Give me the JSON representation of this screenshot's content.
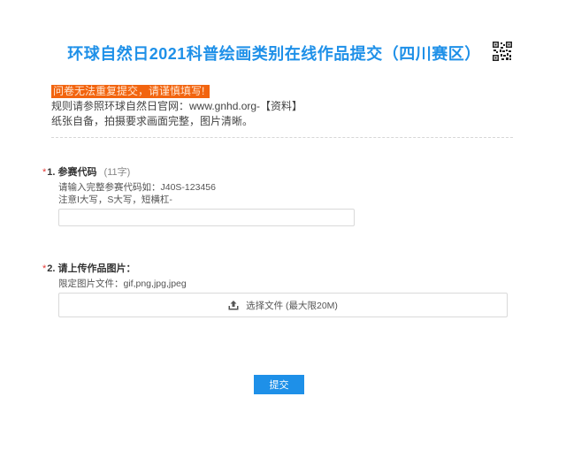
{
  "header": {
    "title": "环球自然日2021科普绘画类别在线作品提交（四川赛区）",
    "qr_icon": "qr-code-icon"
  },
  "notice": {
    "warning": "问卷无法重复提交，请谨慎填写!",
    "line1": "规则请参照环球自然日官网：www.gnhd.org-【资料】",
    "line2": "纸张自备，拍摄要求画面完整，图片清晰。"
  },
  "questions": [
    {
      "required_mark": "*",
      "number": "1.",
      "label": "参赛代码",
      "hint": "(11字)",
      "desc_line1": "请输入完整参赛代码如：J40S-123456",
      "desc_line2": "注意I大写，S大写，短横杠-",
      "input_value": ""
    },
    {
      "required_mark": "*",
      "number": "2.",
      "label": "请上传作品图片：",
      "desc_line1": "限定图片文件：gif,png,jpg,jpeg",
      "upload_icon": "upload-icon",
      "upload_label": "选择文件 (最大限20M)"
    }
  ],
  "submit_label": "提交",
  "colors": {
    "accent": "#1e90e8",
    "warning_bg": "#f2640f",
    "required": "#e53935"
  }
}
